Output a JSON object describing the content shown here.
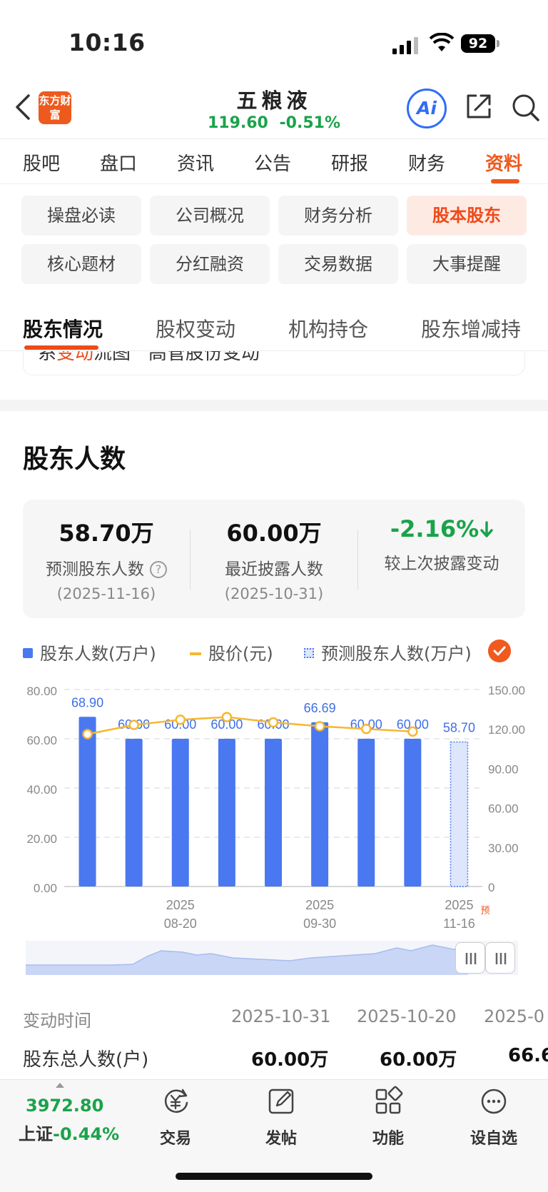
{
  "status": {
    "time": "10:16",
    "battery": "92"
  },
  "header": {
    "logo": "东方财富",
    "stock_name": "五粮液",
    "price": "119.60",
    "change": "-0.51%",
    "ai_label": "Ai"
  },
  "main_tabs": [
    "股吧",
    "盘口",
    "资讯",
    "公告",
    "研报",
    "财务",
    "资料"
  ],
  "chips": [
    "操盘必读",
    "公司概况",
    "财务分析",
    "股本股东",
    "核心题材",
    "分红融资",
    "交易数据",
    "大事提醒"
  ],
  "sub_tabs": [
    "股东情况",
    "股权变动",
    "机构持仓",
    "股东增减持"
  ],
  "clipped_card": {
    "left_a": "系",
    "left_red": "变动",
    "left_b": "流图",
    "right": "高管股份变动"
  },
  "section_title": "股东人数",
  "summary": {
    "predicted": {
      "value": "58.70万",
      "label": "预测股东人数",
      "date": "(2025-11-16)"
    },
    "latest": {
      "value": "60.00万",
      "label": "最近披露人数",
      "date": "(2025-10-31)"
    },
    "change": {
      "value": "-2.16%",
      "label": "较上次披露变动"
    }
  },
  "legend": {
    "holders": "股东人数(万户)",
    "price": "股价(元)",
    "predicted": "预测股东人数(万户)"
  },
  "colors": {
    "accent": "#ee5a1e",
    "bar": "#4a78f0",
    "line": "#f6b731",
    "down": "#1aa34a"
  },
  "chart_data": {
    "type": "bar",
    "series": [
      {
        "name": "股东人数(万户)",
        "axis": "left",
        "values": [
          68.9,
          60.0,
          60.0,
          60.0,
          60.0,
          66.69,
          60.0,
          60.0,
          58.7
        ],
        "predicted_last": true
      },
      {
        "name": "股价(元)",
        "axis": "right",
        "type": "line",
        "values": [
          116,
          123,
          127,
          129,
          125,
          122,
          120,
          118
        ]
      }
    ],
    "data_labels": [
      "68.90",
      "60.00",
      "60.00",
      "60.00",
      "60.00",
      "66.69",
      "60.00",
      "60.00",
      "58.70"
    ],
    "y_left_ticks": [
      "80.00",
      "60.00",
      "40.00",
      "20.00",
      "0.00"
    ],
    "y_right_ticks": [
      "150.00",
      "120.00",
      "90.00",
      "60.00",
      "30.00",
      "0"
    ],
    "x_ticks": [
      {
        "index": 2,
        "year": "2025",
        "date": "08-20"
      },
      {
        "index": 5,
        "year": "2025",
        "date": "09-30"
      },
      {
        "index": 8,
        "year": "2025",
        "date": "11-16"
      }
    ],
    "predicted_tag": "预",
    "ylim_left": [
      0,
      80
    ],
    "ylim_right": [
      0,
      150
    ],
    "grid": true
  },
  "table": {
    "head_label": "变动时间",
    "dates": [
      "2025-10-31",
      "2025-10-20",
      "2025-0"
    ],
    "row_label": "股东总人数(户)",
    "row_values": [
      "60.00万",
      "60.00万",
      "66.6"
    ]
  },
  "bottom_bar": {
    "index_value": "3972.80",
    "index_name": "上证",
    "index_change": "-0.44%",
    "items": [
      "交易",
      "发帖",
      "功能",
      "设自选"
    ]
  }
}
